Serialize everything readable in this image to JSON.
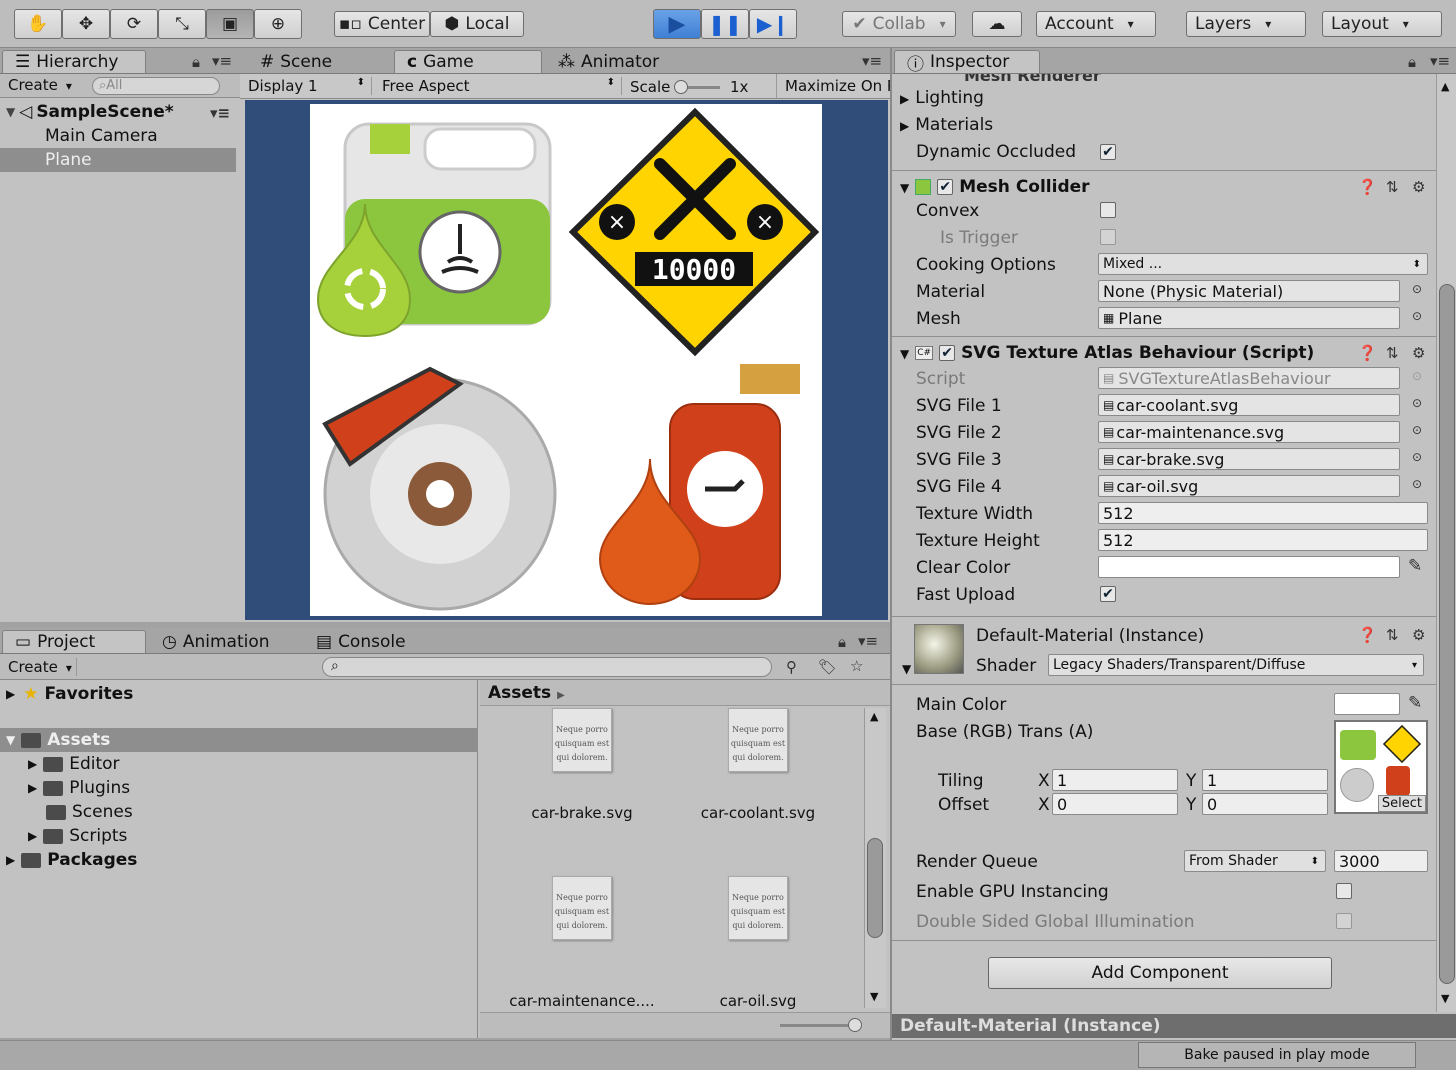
{
  "toolbar": {
    "tools": [
      "hand-icon",
      "move-icon",
      "rotate-icon",
      "scale-icon",
      "rect-icon",
      "transform-icon"
    ],
    "pivot": "Center",
    "space": "Local",
    "collab": "Collab",
    "account": "Account",
    "layers": "Layers",
    "layout": "Layout"
  },
  "hierarchy": {
    "tab": "Hierarchy",
    "create": "Create",
    "search_placeholder": "All",
    "scene": "SampleScene*",
    "items": [
      "Main Camera",
      "Plane"
    ]
  },
  "scene_tabs": {
    "scene": "Scene",
    "game": "Game",
    "animator": "Animator"
  },
  "game_bar": {
    "display": "Display 1",
    "aspect": "Free Aspect",
    "scale_label": "Scale",
    "scale_value": "1x",
    "maximize": "Maximize On Pl"
  },
  "game_view": {
    "odometer": "10000"
  },
  "project": {
    "tabs": [
      "Project",
      "Animation",
      "Console"
    ],
    "create": "Create",
    "favorites": "Favorites",
    "assets": "Assets",
    "folders": [
      "Editor",
      "Plugins",
      "Scenes",
      "Scripts"
    ],
    "packages": "Packages",
    "breadcrumb": "Assets",
    "files": [
      "car-brake.svg",
      "car-coolant.svg",
      "car-maintenance....",
      "car-oil.svg"
    ],
    "file_preview_text": "Neque porro quisquam est qui dolorem."
  },
  "inspector": {
    "tab": "Inspector",
    "cut_header": "Mesh Renderer",
    "lighting": "Lighting",
    "materials": "Materials",
    "dynamic_occluded": "Dynamic Occluded",
    "mesh_collider": {
      "title": "Mesh Collider",
      "convex": "Convex",
      "is_trigger": "Is Trigger",
      "cooking": "Cooking Options",
      "cooking_value": "Mixed ...",
      "material": "Material",
      "material_value": "None (Physic Material)",
      "mesh": "Mesh",
      "mesh_value": "Plane"
    },
    "svg_behaviour": {
      "title": "SVG Texture Atlas Behaviour (Script)",
      "script": "Script",
      "script_value": "SVGTextureAtlasBehaviour",
      "file1": "SVG File 1",
      "file1_value": "car-coolant.svg",
      "file2": "SVG File 2",
      "file2_value": "car-maintenance.svg",
      "file3": "SVG File 3",
      "file3_value": "car-brake.svg",
      "file4": "SVG File 4",
      "file4_value": "car-oil.svg",
      "tex_w": "Texture Width",
      "tex_w_value": "512",
      "tex_h": "Texture Height",
      "tex_h_value": "512",
      "clear_color": "Clear Color",
      "fast_upload": "Fast Upload"
    },
    "material": {
      "title": "Default-Material (Instance)",
      "shader_label": "Shader",
      "shader_value": "Legacy Shaders/Transparent/Diffuse",
      "main_color": "Main Color",
      "base": "Base (RGB) Trans (A)",
      "tiling": "Tiling",
      "offset": "Offset",
      "x": "X",
      "y": "Y",
      "tiling_x": "1",
      "tiling_y": "1",
      "offset_x": "0",
      "offset_y": "0",
      "select": "Select",
      "render_queue": "Render Queue",
      "render_queue_mode": "From Shader",
      "render_queue_value": "3000",
      "gpu_instancing": "Enable GPU Instancing",
      "double_sided": "Double Sided Global Illumination"
    },
    "add_component": "Add Component",
    "footer": "Default-Material (Instance)"
  },
  "status": {
    "bake": "Bake paused in play mode"
  },
  "colors": {
    "play_active": "#3f7fd3",
    "game_bg": "#2f4d78",
    "accent_yellow": "#ffd400",
    "coolant_green": "#8cc63f",
    "oil_red": "#d0401a"
  }
}
